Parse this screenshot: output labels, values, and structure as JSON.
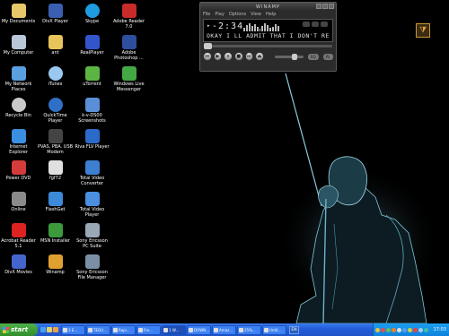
{
  "desktop": {
    "icons": [
      {
        "label": "My Documents",
        "icon": "folder-docs-icon",
        "color": "#e7c86a"
      },
      {
        "label": "My Computer",
        "icon": "computer-icon",
        "color": "#b9c7d9"
      },
      {
        "label": "My Network Places",
        "icon": "network-icon",
        "color": "#5aa0e0"
      },
      {
        "label": "Recycle Bin",
        "icon": "recycle-bin-icon",
        "color": "#c9c9c9"
      },
      {
        "label": "Internet Explorer",
        "icon": "internet-explorer-icon",
        "color": "#3b8fe0"
      },
      {
        "label": "Power DVD",
        "icon": "dvd-icon",
        "color": "#d43b3b"
      },
      {
        "label": "Online",
        "icon": "online-icon",
        "color": "#8a8a8a"
      },
      {
        "label": "Acrobat Reader 5.1",
        "icon": "acrobat-icon",
        "color": "#d22"
      },
      {
        "label": "DivX Movies",
        "icon": "divx-icon",
        "color": "#4466cc"
      },
      {
        "label": "",
        "icon": "blank-icon",
        "color": "#000000"
      },
      {
        "label": "DivX Player",
        "icon": "divx-player-icon",
        "color": "#3a5fb0"
      },
      {
        "label": "ant",
        "icon": "folder-icon",
        "color": "#e8c55a"
      },
      {
        "label": "iTunes",
        "icon": "itunes-icon",
        "color": "#9ac8f0"
      },
      {
        "label": "QuickTime Player",
        "icon": "quicktime-icon",
        "color": "#2f6fc7"
      },
      {
        "label": "PVAS, PBA. USB Modem",
        "icon": "modem-icon",
        "color": "#444"
      },
      {
        "label": "fgf72",
        "icon": "doc-icon",
        "color": "#e0e0e0"
      },
      {
        "label": "FlashGet",
        "icon": "flashget-icon",
        "color": "#3c8ad8"
      },
      {
        "label": "MSN Installer",
        "icon": "msn-icon",
        "color": "#3c9a3c"
      },
      {
        "label": "Winamp",
        "icon": "winamp-icon",
        "color": "#e0a030"
      },
      {
        "label": "",
        "icon": "blank-icon",
        "color": "#000000"
      },
      {
        "label": "Skype",
        "icon": "skype-icon",
        "color": "#1f9be0"
      },
      {
        "label": "RealPlayer",
        "icon": "realplayer-icon",
        "color": "#3355cc"
      },
      {
        "label": "uTorrent",
        "icon": "utorrent-icon",
        "color": "#5bb543"
      },
      {
        "label": "k-v-DS00 Screenshots",
        "icon": "camera-icon",
        "color": "#5a8fd8"
      },
      {
        "label": "Riva FLV Player",
        "icon": "flv-player-icon",
        "color": "#2a6ac8"
      },
      {
        "label": "Total Video Converter",
        "icon": "video-converter-icon",
        "color": "#3d7fd0"
      },
      {
        "label": "Total Video Player",
        "icon": "video-player-icon",
        "color": "#4a8fe0"
      },
      {
        "label": "Sony Ericsson PC Suite",
        "icon": "phone-suite-icon",
        "color": "#9aa8b6"
      },
      {
        "label": "Sony Ericsson File Manager",
        "icon": "file-manager-icon",
        "color": "#7a8fa6"
      },
      {
        "label": "",
        "icon": "blank-icon",
        "color": "#000000"
      },
      {
        "label": "Adobe Reader 7.0",
        "icon": "adobe-reader-icon",
        "color": "#c92a2a"
      },
      {
        "label": "Adobe Photoshop ...",
        "icon": "photoshop-icon",
        "color": "#2d4f9e"
      },
      {
        "label": "Windows Live Messenger",
        "icon": "messenger-icon",
        "color": "#44a844"
      }
    ]
  },
  "winamp": {
    "title": "WINAMP",
    "menu": [
      "File",
      "Play",
      "Options",
      "View",
      "Help"
    ],
    "time": "-2:34",
    "play_indicator": "▸",
    "song": "OKAY I LL ADMIT THAT I DON'T RE",
    "controls": [
      "⏮",
      "▶",
      "⏸",
      "■",
      "⏭"
    ],
    "eject": "⏏",
    "pills": [
      "EQ",
      "PL"
    ],
    "seek_fraction": 0.0,
    "volume_fraction": 0.7
  },
  "corner_icon": {
    "icon": "winamp-tray-icon",
    "glyph": "⧩"
  },
  "taskbar": {
    "start_label": "start",
    "quick_launch": [
      {
        "icon": "ie-quicklaunch-icon",
        "color": "#4aa0f0"
      },
      {
        "icon": "desktop-quicklaunch-icon",
        "color": "#e0d070"
      },
      {
        "icon": "media-quicklaunch-icon",
        "color": "#f0a040"
      }
    ],
    "tasks": [
      {
        "label": "3 E...",
        "icon": "folder-task-icon",
        "active": false
      },
      {
        "label": "TEGU...",
        "icon": "app-task-icon",
        "active": false
      },
      {
        "label": "Rapi...",
        "icon": "app-task-icon",
        "active": false
      },
      {
        "label": "Fre...",
        "icon": "app-task-icon",
        "active": false
      },
      {
        "label": "1 W...",
        "icon": "winamp-task-icon",
        "active": true
      },
      {
        "label": "DOWN...",
        "icon": "app-task-icon",
        "active": false
      },
      {
        "label": "Amaz...",
        "icon": "app-task-icon",
        "active": false
      },
      {
        "label": "25%...",
        "icon": "download-task-icon",
        "active": false
      },
      {
        "label": "Untit...",
        "icon": "paint-task-icon",
        "active": false
      }
    ],
    "language": "EN",
    "tray_icons": [
      {
        "icon": "tray-icon-1",
        "color": "#f0c040"
      },
      {
        "icon": "tray-icon-2",
        "color": "#e05050"
      },
      {
        "icon": "tray-icon-3",
        "color": "#60c060"
      },
      {
        "icon": "tray-icon-4",
        "color": "#f08030"
      },
      {
        "icon": "tray-icon-5",
        "color": "#e0e0e0"
      },
      {
        "icon": "tray-icon-6",
        "color": "#50a0f0"
      },
      {
        "icon": "tray-icon-7",
        "color": "#d0d040"
      },
      {
        "icon": "tray-icon-8",
        "color": "#f04040"
      },
      {
        "icon": "tray-icon-9",
        "color": "#a0d0f0"
      },
      {
        "icon": "tray-icon-10",
        "color": "#40c0a0"
      }
    ],
    "clock": "17:03"
  }
}
